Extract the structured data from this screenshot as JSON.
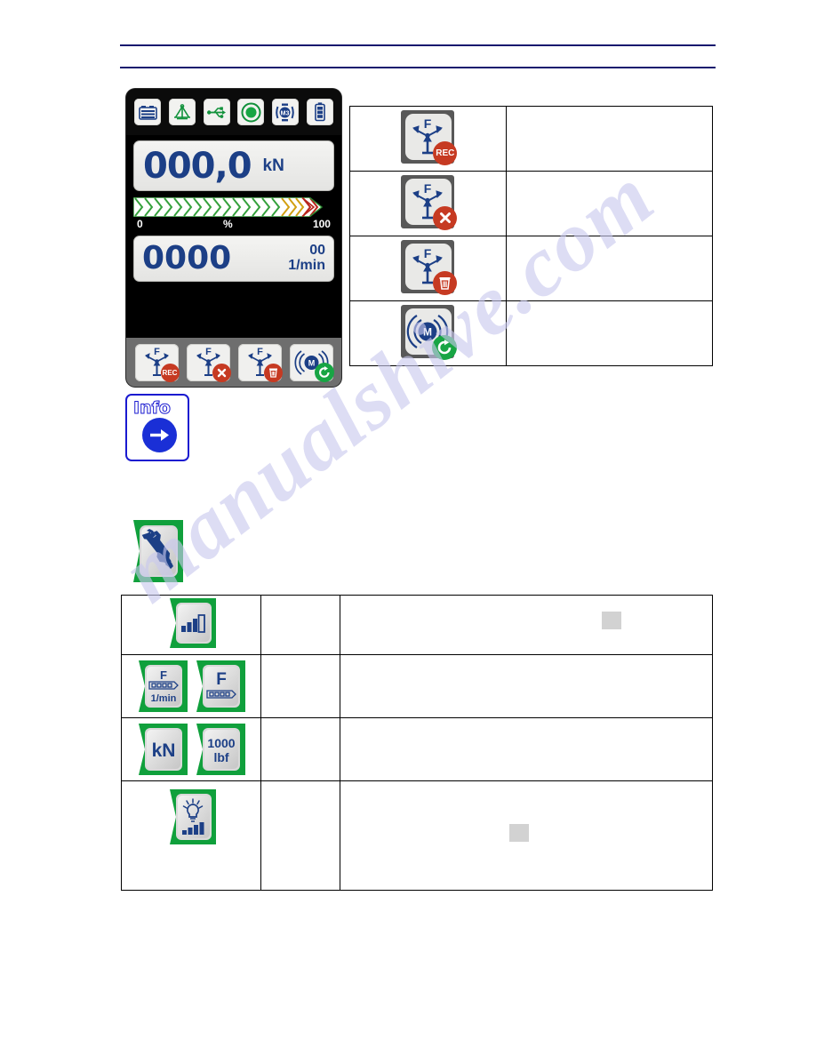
{
  "document": {
    "watermark": "manualshive.com"
  },
  "device": {
    "status_icons": [
      {
        "name": "battery-pack-icon",
        "label": "battery-pack"
      },
      {
        "name": "scale-balance-icon",
        "label": "scale-balance"
      },
      {
        "name": "usb-icon",
        "label": "usb"
      },
      {
        "name": "record-dot-icon",
        "label": "record-dot"
      },
      {
        "name": "m3-torque-icon",
        "label": "M3"
      },
      {
        "name": "battery-level-icon",
        "label": "battery-level"
      }
    ],
    "force_display": {
      "value": "000,0",
      "unit": "kN"
    },
    "bargraph": {
      "scale_min": "0",
      "scale_unit": "%",
      "scale_max": "100"
    },
    "rpm_display": {
      "value": "0000",
      "secondary": "00",
      "unit": "1/min"
    },
    "softkeys": [
      {
        "name": "force-record-key",
        "badge": "REC"
      },
      {
        "name": "force-cancel-key",
        "badge": "x"
      },
      {
        "name": "force-delete-key",
        "badge": "trash"
      },
      {
        "name": "motor-restart-key",
        "badge": "reset"
      }
    ]
  },
  "info_box": {
    "label": "Info",
    "arrow": "→"
  },
  "tools_key": {
    "name": "wrench-settings-key"
  },
  "top_table": {
    "rows": [
      {
        "icon": "force-record-icon",
        "badge": "REC",
        "description": ""
      },
      {
        "icon": "force-cancel-icon",
        "badge": "x",
        "description": ""
      },
      {
        "icon": "force-delete-icon",
        "badge": "trash",
        "description": ""
      },
      {
        "icon": "motor-restart-icon",
        "badge": "reset",
        "description": ""
      }
    ]
  },
  "bottom_table": {
    "rows": [
      {
        "icons": [
          "contrast-level-icon"
        ],
        "mid": "",
        "description": "",
        "grey_box": true
      },
      {
        "icons": [
          "force-rpm-bar-icon",
          "force-bar-icon"
        ],
        "mid": "",
        "description": "",
        "grey_box": false,
        "labels": {
          "top": "F",
          "bottom": "1/min",
          "second_top": "F"
        }
      },
      {
        "icons": [
          "kn-unit-icon",
          "lbf-unit-icon"
        ],
        "mid": "",
        "description": "",
        "grey_box": false,
        "labels": {
          "kn": "kN",
          "lbf_num": "1000",
          "lbf_unit": "lbf"
        }
      },
      {
        "icons": [
          "backlight-level-icon"
        ],
        "mid": "",
        "description": "",
        "grey_box": true
      }
    ]
  },
  "colors": {
    "rule": "#14186e",
    "lcd_text": "#1c3f86",
    "green_key": "#10a03c",
    "red_badge": "#c63a22",
    "info_blue": "#1a2fd6",
    "watermark": "#c9c9ee"
  }
}
